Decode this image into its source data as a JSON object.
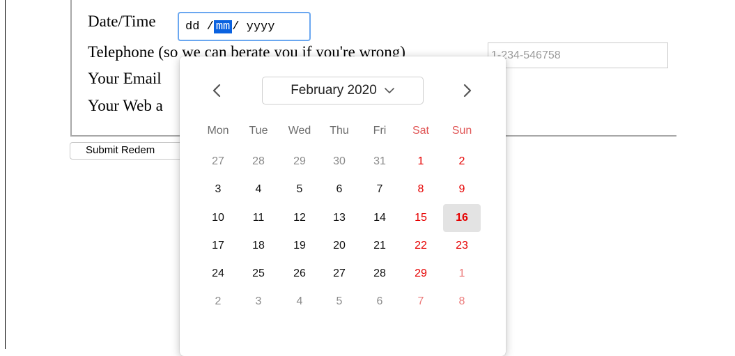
{
  "form": {
    "date_label": "Date/Time",
    "date_segments": {
      "day": "dd",
      "sep1": " /",
      "month": "mm",
      "sep2": "/ ",
      "year": "yyyy"
    },
    "telephone_label": "Telephone (so we can berate you if you're wrong)",
    "telephone_placeholder": "1-234-546758",
    "email_label": "Your Email",
    "web_label": "Your Web a",
    "submit_label": "Submit Redem"
  },
  "picker": {
    "month_label": "February 2020",
    "weekdays": [
      "Mon",
      "Tue",
      "Wed",
      "Thu",
      "Fri",
      "Sat",
      "Sun"
    ],
    "weeks": [
      [
        {
          "d": "27",
          "other": true
        },
        {
          "d": "28",
          "other": true
        },
        {
          "d": "29",
          "other": true
        },
        {
          "d": "30",
          "other": true
        },
        {
          "d": "31",
          "other": true
        },
        {
          "d": "1"
        },
        {
          "d": "2"
        }
      ],
      [
        {
          "d": "3"
        },
        {
          "d": "4"
        },
        {
          "d": "5"
        },
        {
          "d": "6"
        },
        {
          "d": "7"
        },
        {
          "d": "8"
        },
        {
          "d": "9"
        }
      ],
      [
        {
          "d": "10"
        },
        {
          "d": "11"
        },
        {
          "d": "12"
        },
        {
          "d": "13"
        },
        {
          "d": "14"
        },
        {
          "d": "15"
        },
        {
          "d": "16",
          "today": true
        }
      ],
      [
        {
          "d": "17"
        },
        {
          "d": "18"
        },
        {
          "d": "19"
        },
        {
          "d": "20"
        },
        {
          "d": "21"
        },
        {
          "d": "22"
        },
        {
          "d": "23"
        }
      ],
      [
        {
          "d": "24"
        },
        {
          "d": "25"
        },
        {
          "d": "26"
        },
        {
          "d": "27"
        },
        {
          "d": "28"
        },
        {
          "d": "29"
        },
        {
          "d": "1",
          "other": true
        }
      ],
      [
        {
          "d": "2",
          "other": true
        },
        {
          "d": "3",
          "other": true
        },
        {
          "d": "4",
          "other": true
        },
        {
          "d": "5",
          "other": true
        },
        {
          "d": "6",
          "other": true
        },
        {
          "d": "7",
          "other": true
        },
        {
          "d": "8",
          "other": true
        }
      ]
    ]
  },
  "icons": {
    "prev": "chevron-left-icon",
    "next": "chevron-right-icon",
    "dropdown": "chevron-down-icon"
  },
  "colors": {
    "selection": "#0a62e0",
    "focus_ring": "#6aa7f0",
    "weekend": "#e60000",
    "today_bg": "#e3e3e3"
  }
}
